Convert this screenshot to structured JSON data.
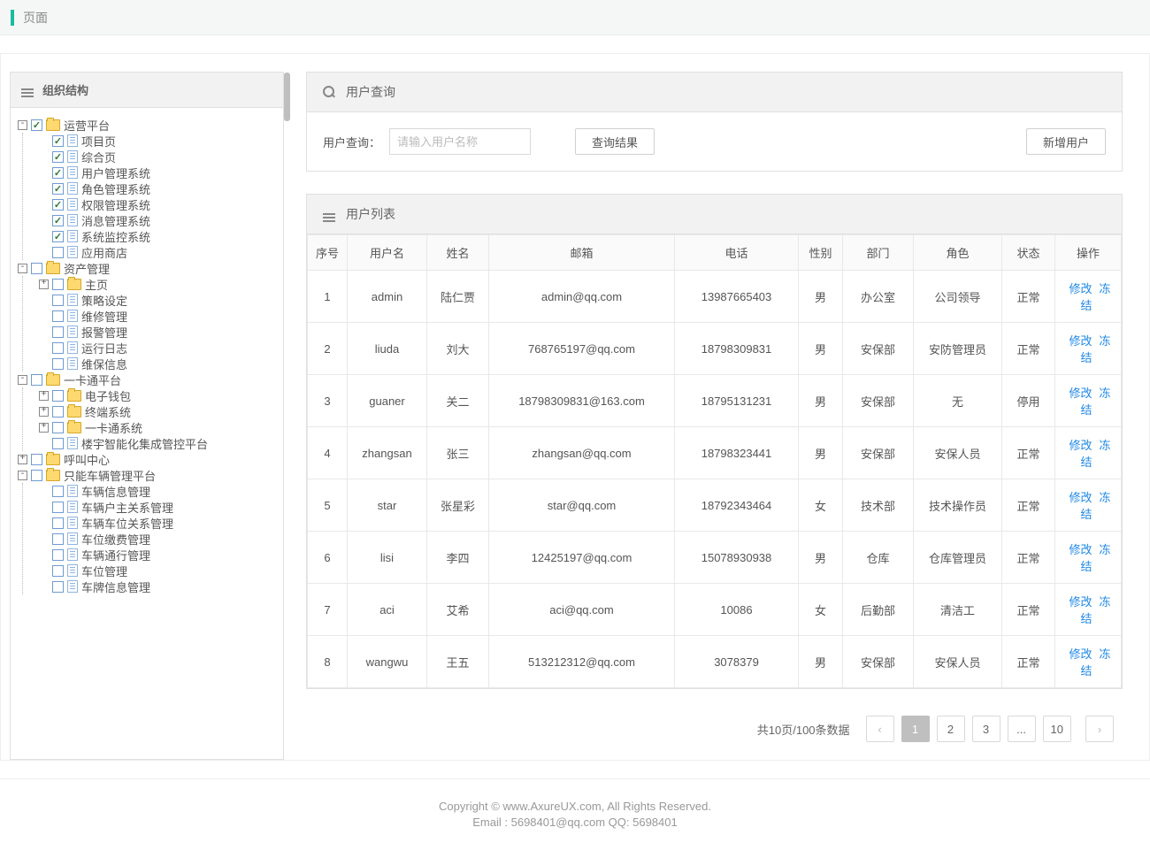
{
  "header": {
    "title": "页面"
  },
  "sidebar": {
    "title": "组织结构",
    "tree": [
      {
        "label": "运营平台",
        "type": "folder",
        "toggle": "-",
        "checked": true,
        "children": [
          {
            "label": "项目页",
            "type": "file",
            "checked": true
          },
          {
            "label": "综合页",
            "type": "file",
            "checked": true
          },
          {
            "label": "用户管理系统",
            "type": "file",
            "checked": true
          },
          {
            "label": "角色管理系统",
            "type": "file",
            "checked": true
          },
          {
            "label": "权限管理系统",
            "type": "file",
            "checked": true
          },
          {
            "label": "消息管理系统",
            "type": "file",
            "checked": true
          },
          {
            "label": "系统监控系统",
            "type": "file",
            "checked": true
          },
          {
            "label": "应用商店",
            "type": "file",
            "checked": false
          }
        ]
      },
      {
        "label": "资产管理",
        "type": "folder",
        "toggle": "-",
        "checked": false,
        "children": [
          {
            "label": "主页",
            "type": "folder",
            "toggle": "+",
            "checked": false
          },
          {
            "label": "策略设定",
            "type": "file",
            "checked": false
          },
          {
            "label": "维修管理",
            "type": "file",
            "checked": false
          },
          {
            "label": "报警管理",
            "type": "file",
            "checked": false
          },
          {
            "label": "运行日志",
            "type": "file",
            "checked": false
          },
          {
            "label": "维保信息",
            "type": "file",
            "checked": false
          }
        ]
      },
      {
        "label": "一卡通平台",
        "type": "folder",
        "toggle": "-",
        "checked": false,
        "children": [
          {
            "label": "电子钱包",
            "type": "folder",
            "toggle": "+",
            "checked": false
          },
          {
            "label": "终端系统",
            "type": "folder",
            "toggle": "+",
            "checked": false
          },
          {
            "label": "一卡通系统",
            "type": "folder",
            "toggle": "+",
            "checked": false
          },
          {
            "label": "楼宇智能化集成管控平台",
            "type": "file",
            "checked": false
          }
        ]
      },
      {
        "label": "呼叫中心",
        "type": "folder",
        "toggle": "+",
        "checked": false
      },
      {
        "label": "只能车辆管理平台",
        "type": "folder",
        "toggle": "-",
        "checked": false,
        "children": [
          {
            "label": "车辆信息管理",
            "type": "file",
            "checked": false
          },
          {
            "label": "车辆户主关系管理",
            "type": "file",
            "checked": false
          },
          {
            "label": "车辆车位关系管理",
            "type": "file",
            "checked": false
          },
          {
            "label": "车位缴费管理",
            "type": "file",
            "checked": false
          },
          {
            "label": "车辆通行管理",
            "type": "file",
            "checked": false
          },
          {
            "label": "车位管理",
            "type": "file",
            "checked": false
          },
          {
            "label": "车牌信息管理",
            "type": "file",
            "checked": false
          }
        ]
      }
    ]
  },
  "search": {
    "panel_title": "用户查询",
    "label": "用户查询：",
    "placeholder": "请输入用户名称",
    "query_btn": "查询结果",
    "add_btn": "新增用户"
  },
  "table": {
    "panel_title": "用户列表",
    "columns": [
      "序号",
      "用户名",
      "姓名",
      "邮箱",
      "电话",
      "性别",
      "部门",
      "角色",
      "状态",
      "操作"
    ],
    "actions": {
      "edit": "修改",
      "freeze": "冻结"
    },
    "rows": [
      {
        "idx": "1",
        "user": "admin",
        "name": "陆仁贾",
        "email": "admin@qq.com",
        "phone": "13987665403",
        "gender": "男",
        "dept": "办公室",
        "role": "公司领导",
        "status": "正常"
      },
      {
        "idx": "2",
        "user": "liuda",
        "name": "刘大",
        "email": "768765197@qq.com",
        "phone": "18798309831",
        "gender": "男",
        "dept": "安保部",
        "role": "安防管理员",
        "status": "正常"
      },
      {
        "idx": "3",
        "user": "guaner",
        "name": "关二",
        "email": "18798309831@163.com",
        "phone": "18795131231",
        "gender": "男",
        "dept": "安保部",
        "role": "无",
        "status": "停用"
      },
      {
        "idx": "4",
        "user": "zhangsan",
        "name": "张三",
        "email": "zhangsan@qq.com",
        "phone": "18798323441",
        "gender": "男",
        "dept": "安保部",
        "role": "安保人员",
        "status": "正常"
      },
      {
        "idx": "5",
        "user": "star",
        "name": "张星彩",
        "email": "star@qq.com",
        "phone": "18792343464",
        "gender": "女",
        "dept": "技术部",
        "role": "技术操作员",
        "status": "正常"
      },
      {
        "idx": "6",
        "user": "lisi",
        "name": "李四",
        "email": "12425197@qq.com",
        "phone": "15078930938",
        "gender": "男",
        "dept": "仓库",
        "role": "仓库管理员",
        "status": "正常"
      },
      {
        "idx": "7",
        "user": "aci",
        "name": "艾希",
        "email": "aci@qq.com",
        "phone": "10086",
        "gender": "女",
        "dept": "后勤部",
        "role": "清洁工",
        "status": "正常"
      },
      {
        "idx": "8",
        "user": "wangwu",
        "name": "王五",
        "email": "513212312@qq.com",
        "phone": "3078379",
        "gender": "男",
        "dept": "安保部",
        "role": "安保人员",
        "status": "正常"
      }
    ]
  },
  "pagination": {
    "summary": "共10页/100条数据",
    "pages": [
      "1",
      "2",
      "3",
      "...",
      "10"
    ],
    "active": "1"
  },
  "footer": {
    "line1": "Copyright © www.AxureUX.com, All Rights Reserved.",
    "line2": "Email : 5698401@qq.com  QQ: 5698401"
  }
}
